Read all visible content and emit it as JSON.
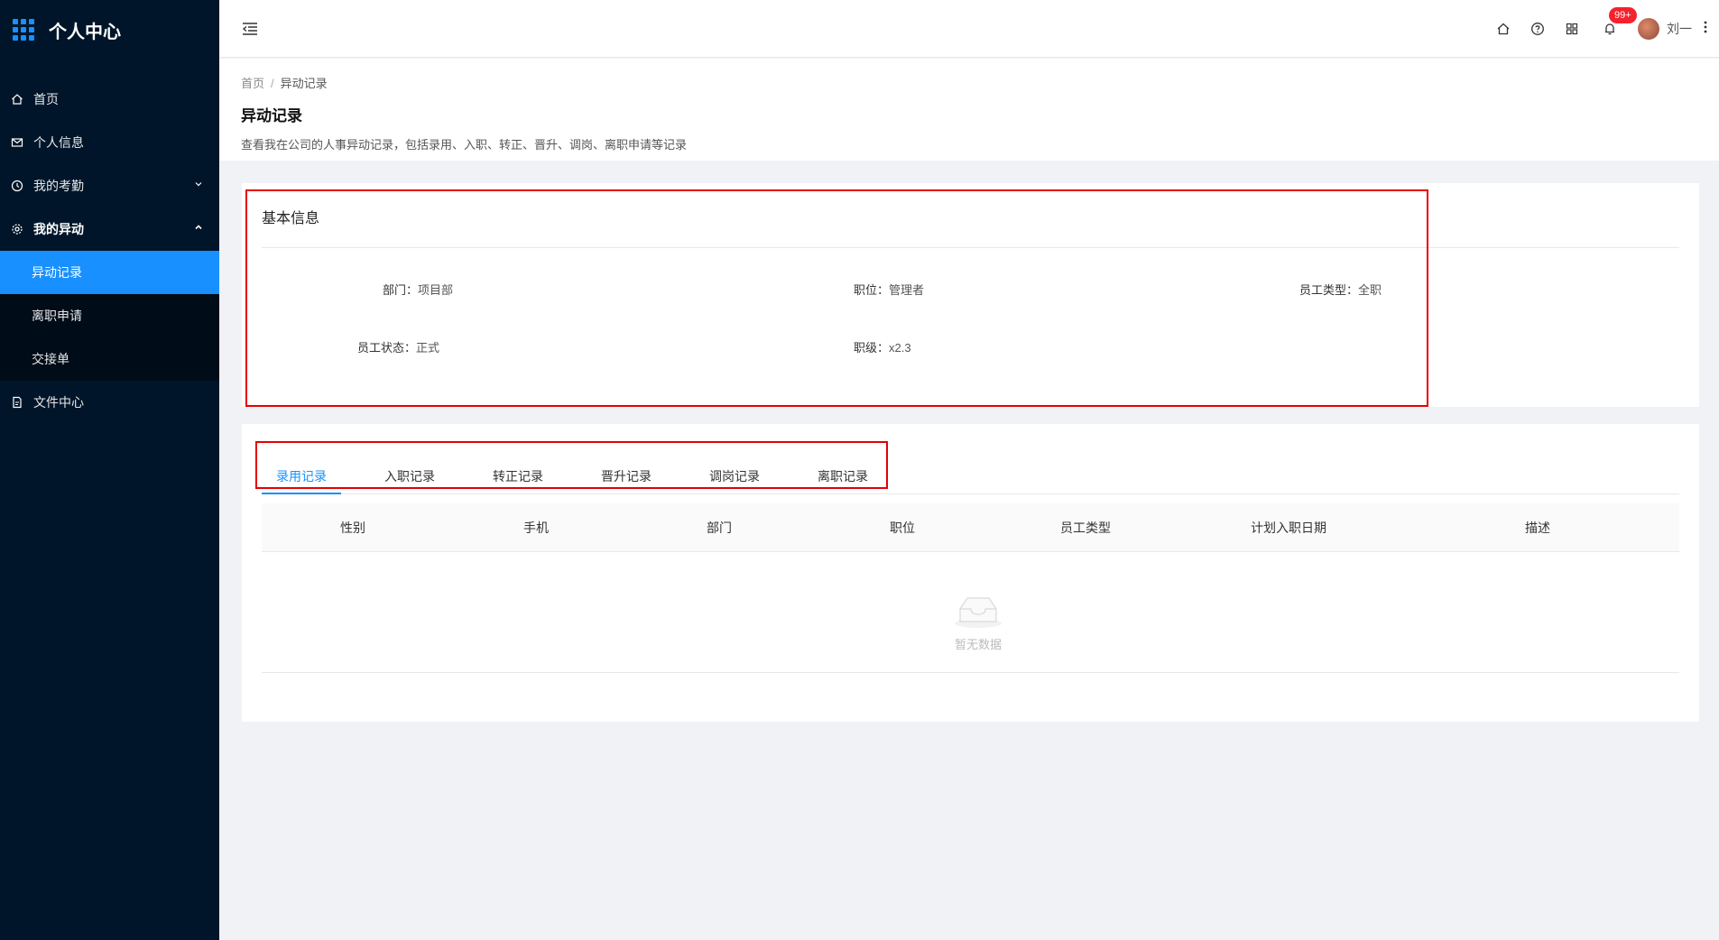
{
  "app": {
    "title": "个人中心"
  },
  "sidebar": {
    "items": [
      {
        "label": "首页",
        "icon": "home-icon"
      },
      {
        "label": "个人信息",
        "icon": "mail-icon"
      },
      {
        "label": "我的考勤",
        "icon": "clock-icon"
      },
      {
        "label": "我的异动",
        "icon": "settings-icon"
      },
      {
        "label": "文件中心",
        "icon": "file-icon"
      }
    ],
    "sub_items": [
      {
        "label": "异动记录",
        "active": true
      },
      {
        "label": "离职申请"
      },
      {
        "label": "交接单"
      }
    ]
  },
  "header": {
    "notification_badge": "99+",
    "user_name": "刘一"
  },
  "page": {
    "breadcrumb": {
      "home": "首页",
      "separator": "/",
      "current": "异动记录"
    },
    "title": "异动记录",
    "description": "查看我在公司的人事异动记录，包括录用、入职、转正、晋升、调岗、离职申请等记录"
  },
  "basic_info": {
    "title": "基本信息",
    "fields": [
      {
        "label": "部门：",
        "value": "项目部"
      },
      {
        "label": "职位：",
        "value": "管理者"
      },
      {
        "label": "员工类型：",
        "value": "全职"
      },
      {
        "label": "员工状态：",
        "value": "正式"
      },
      {
        "label": "职级：",
        "value": "x2.3"
      }
    ]
  },
  "records": {
    "tabs": [
      "录用记录",
      "入职记录",
      "转正记录",
      "晋升记录",
      "调岗记录",
      "离职记录"
    ],
    "active_tab": "录用记录",
    "columns": [
      "性别",
      "手机",
      "部门",
      "职位",
      "员工类型",
      "计划入职日期",
      "描述"
    ],
    "empty_text": "暂无数据"
  },
  "colors": {
    "sidebar_bg": "#001529",
    "accent": "#1890ff",
    "highlight_box": "#e60000"
  }
}
